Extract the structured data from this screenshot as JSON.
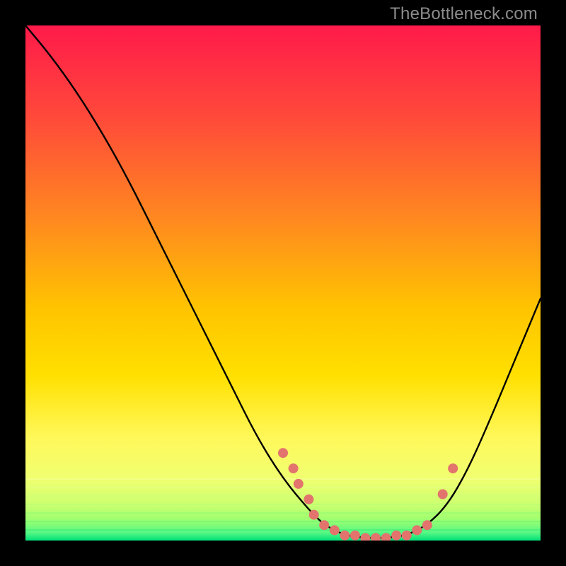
{
  "watermark": "TheBottleneck.com",
  "chart_data": {
    "type": "line",
    "title": "",
    "xlabel": "",
    "ylabel": "",
    "xlim": [
      0,
      100
    ],
    "ylim": [
      0,
      100
    ],
    "gradient_colors": {
      "top": "#ff1a4a",
      "upper_mid": "#ff8a1f",
      "mid": "#ffe000",
      "lower_mid": "#f4ff55",
      "near_bottom": "#d6ff6a",
      "bottom": "#00e079"
    },
    "curve": [
      {
        "x": 0,
        "y": 100
      },
      {
        "x": 5,
        "y": 94
      },
      {
        "x": 10,
        "y": 87
      },
      {
        "x": 15,
        "y": 79
      },
      {
        "x": 20,
        "y": 70
      },
      {
        "x": 25,
        "y": 60
      },
      {
        "x": 30,
        "y": 50
      },
      {
        "x": 35,
        "y": 40
      },
      {
        "x": 40,
        "y": 30
      },
      {
        "x": 45,
        "y": 20
      },
      {
        "x": 50,
        "y": 12
      },
      {
        "x": 55,
        "y": 6
      },
      {
        "x": 58,
        "y": 3
      },
      {
        "x": 62,
        "y": 1
      },
      {
        "x": 66,
        "y": 0.5
      },
      {
        "x": 70,
        "y": 0.5
      },
      {
        "x": 74,
        "y": 1
      },
      {
        "x": 78,
        "y": 3
      },
      {
        "x": 82,
        "y": 7
      },
      {
        "x": 86,
        "y": 14
      },
      {
        "x": 90,
        "y": 23
      },
      {
        "x": 95,
        "y": 35
      },
      {
        "x": 100,
        "y": 47
      }
    ],
    "marker_points": [
      {
        "x": 50,
        "y": 17
      },
      {
        "x": 52,
        "y": 14
      },
      {
        "x": 53,
        "y": 11
      },
      {
        "x": 55,
        "y": 8
      },
      {
        "x": 56,
        "y": 5
      },
      {
        "x": 58,
        "y": 3
      },
      {
        "x": 60,
        "y": 2
      },
      {
        "x": 62,
        "y": 1
      },
      {
        "x": 64,
        "y": 1
      },
      {
        "x": 66,
        "y": 0.5
      },
      {
        "x": 68,
        "y": 0.5
      },
      {
        "x": 70,
        "y": 0.5
      },
      {
        "x": 72,
        "y": 1
      },
      {
        "x": 74,
        "y": 1
      },
      {
        "x": 76,
        "y": 2
      },
      {
        "x": 78,
        "y": 3
      },
      {
        "x": 81,
        "y": 9
      },
      {
        "x": 83,
        "y": 14
      }
    ],
    "marker_color": "#e2736d",
    "marker_radius": 7
  }
}
